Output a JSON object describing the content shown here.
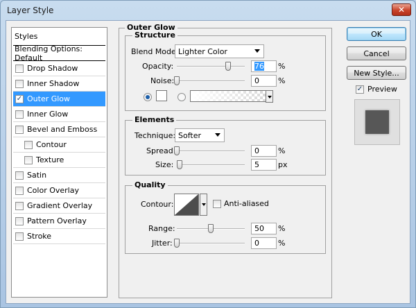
{
  "window": {
    "title": "Layer Style",
    "close_glyph": "✕"
  },
  "styles_panel": {
    "header": "Styles",
    "blending": "Blending Options: Default",
    "items": [
      {
        "label": "Drop Shadow",
        "checked": false,
        "sub": false,
        "selected": false
      },
      {
        "label": "Inner Shadow",
        "checked": false,
        "sub": false,
        "selected": false
      },
      {
        "label": "Outer Glow",
        "checked": true,
        "sub": false,
        "selected": true
      },
      {
        "label": "Inner Glow",
        "checked": false,
        "sub": false,
        "selected": false
      },
      {
        "label": "Bevel and Emboss",
        "checked": false,
        "sub": false,
        "selected": false
      },
      {
        "label": "Contour",
        "checked": false,
        "sub": true,
        "selected": false
      },
      {
        "label": "Texture",
        "checked": false,
        "sub": true,
        "selected": false
      },
      {
        "label": "Satin",
        "checked": false,
        "sub": false,
        "selected": false
      },
      {
        "label": "Color Overlay",
        "checked": false,
        "sub": false,
        "selected": false
      },
      {
        "label": "Gradient Overlay",
        "checked": false,
        "sub": false,
        "selected": false
      },
      {
        "label": "Pattern Overlay",
        "checked": false,
        "sub": false,
        "selected": false
      },
      {
        "label": "Stroke",
        "checked": false,
        "sub": false,
        "selected": false
      }
    ]
  },
  "outer_glow": {
    "title": "Outer Glow",
    "structure": {
      "title": "Structure",
      "blend_mode_label": "Blend Mode:",
      "blend_mode_value": "Lighter Color",
      "opacity_label": "Opacity:",
      "opacity_value": "76",
      "opacity_unit": "%",
      "noise_label": "Noise:",
      "noise_value": "0",
      "noise_unit": "%",
      "color_mode": "solid",
      "solid_color": "#ffffff"
    },
    "elements": {
      "title": "Elements",
      "technique_label": "Technique:",
      "technique_value": "Softer",
      "spread_label": "Spread:",
      "spread_value": "0",
      "spread_unit": "%",
      "size_label": "Size:",
      "size_value": "5",
      "size_unit": "px"
    },
    "quality": {
      "title": "Quality",
      "contour_label": "Contour:",
      "anti_aliased_label": "Anti-aliased",
      "anti_aliased": false,
      "range_label": "Range:",
      "range_value": "50",
      "range_unit": "%",
      "jitter_label": "Jitter:",
      "jitter_value": "0",
      "jitter_unit": "%"
    }
  },
  "buttons": {
    "ok": "OK",
    "cancel": "Cancel",
    "new_style": "New Style..."
  },
  "preview": {
    "label": "Preview",
    "checked": true,
    "square_color": "#575757"
  }
}
